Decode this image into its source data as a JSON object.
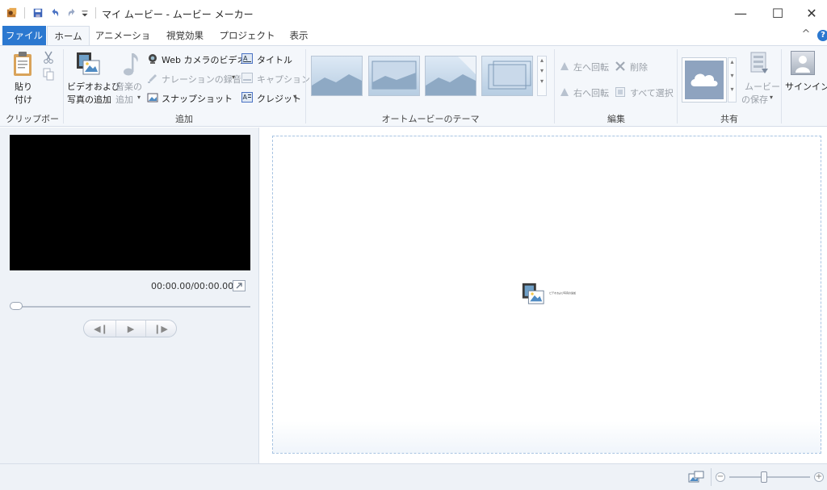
{
  "titlebar": {
    "title": "マイ ムービー - ムービー メーカー",
    "minimize": "—",
    "maximize": "☐",
    "close": "✕"
  },
  "tabs": {
    "file": "ファイル",
    "items": [
      "ホーム",
      "アニメーション",
      "視覚効果",
      "プロジェクト",
      "表示"
    ],
    "help": "?",
    "collapse": "^"
  },
  "ribbon": {
    "clipboard": {
      "paste": "貼り",
      "paste2": "付け",
      "group": "クリップボード"
    },
    "add": {
      "video_photo_1": "ビデオおよび",
      "video_photo_2": "写真の追加",
      "music_1": "音楽の",
      "music_2": "追加",
      "webcam": "Web カメラのビデオ",
      "narration": "ナレーションの録音",
      "snapshot": "スナップショット",
      "title": "タイトル",
      "caption": "キャプション",
      "credit": "クレジット",
      "group": "追加"
    },
    "themes": {
      "group": "オートムービーのテーマ"
    },
    "edit": {
      "rotate_left": "左へ回転",
      "rotate_right": "右へ回転",
      "delete": "削除",
      "select_all": "すべて選択",
      "group": "編集"
    },
    "share": {
      "save_movie_1": "ムービー",
      "save_movie_2": "の保存",
      "group": "共有"
    },
    "signin": {
      "label": "サインイン"
    }
  },
  "player": {
    "time": "00:00.00/00:00.00"
  },
  "storyboard": {
    "hint": "ビデオおよび写真の追加"
  },
  "colors": {
    "accent": "#2b78d0",
    "ribbon_bg": "#f4f7fb"
  }
}
